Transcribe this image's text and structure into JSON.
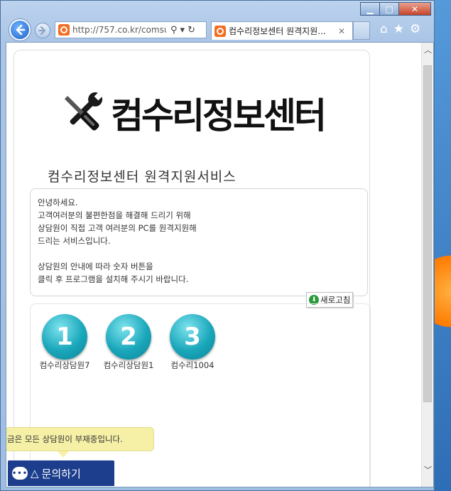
{
  "window": {
    "caption": {
      "minimize": "▁",
      "maximize": "□",
      "close": "✕"
    }
  },
  "browser": {
    "url": "http://757.co.kr/comsu",
    "tab_title": "컴수리정보센터 원격지원...",
    "tab_close": "✕"
  },
  "page": {
    "logo_text": "컴수리정보센터",
    "title": "컴수리정보센터 원격지원서비스",
    "info_lines": [
      "안녕하세요.",
      "고객여러분의 불편한점을 해결해 드리기 위해",
      "상담원이 직접 고객 여러분의 PC를 원격지원해",
      "드리는 서비스입니다.",
      "상담원의 안내에 따라 숫자 버튼을",
      "클릭 후 프로그램을 설치해 주시기 바랍니다."
    ],
    "refresh_label": "새로고침",
    "agents": [
      {
        "number": "1",
        "name": "컴수리상담원7"
      },
      {
        "number": "2",
        "name": "컴수리상담원1"
      },
      {
        "number": "3",
        "name": "컴수리1004"
      }
    ],
    "tooltip": "금은 모든 상담원이 부재중입니다.",
    "chat_label": "문의하기",
    "chat_prefix": "△"
  }
}
